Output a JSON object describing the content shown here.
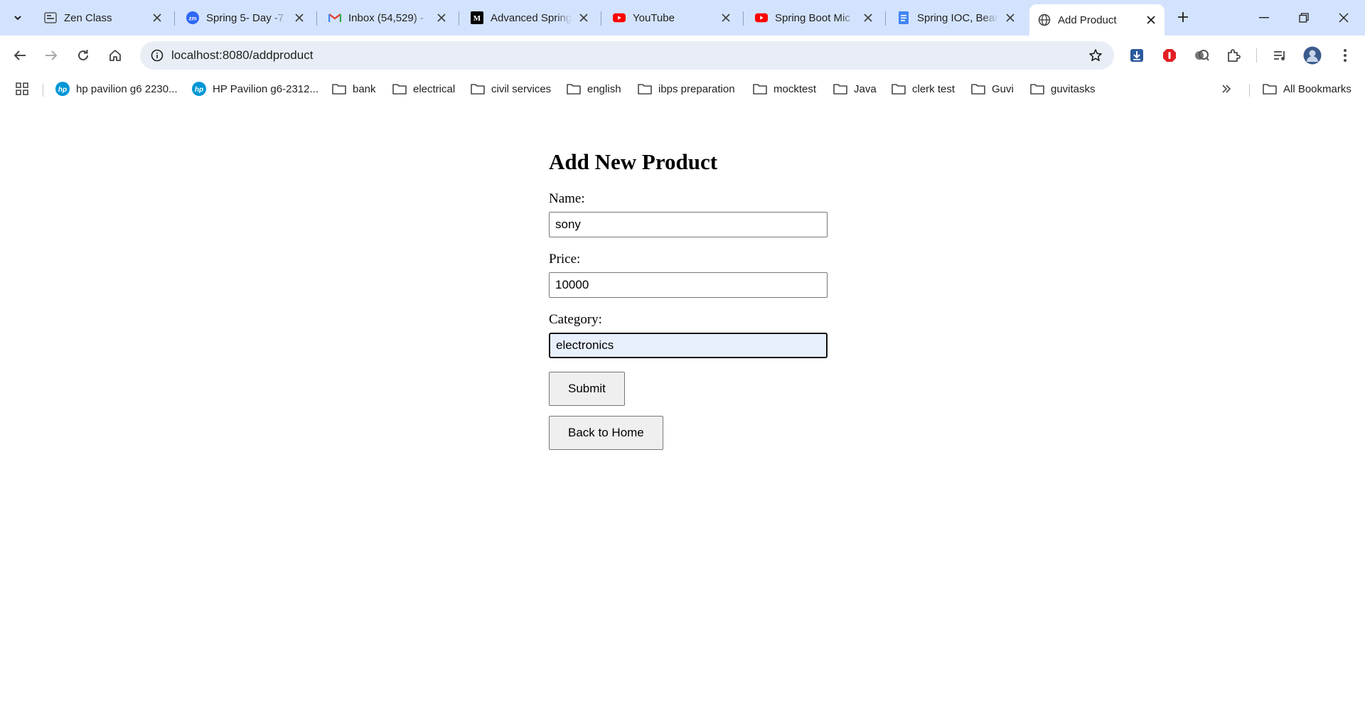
{
  "browser": {
    "tabs": [
      {
        "title": "Zen Class",
        "icon": "zen-class-icon"
      },
      {
        "title": "Spring 5- Day -7",
        "icon": "zoom-icon"
      },
      {
        "title": "Inbox (54,529) -",
        "icon": "gmail-icon"
      },
      {
        "title": "Advanced Spring",
        "icon": "medium-icon"
      },
      {
        "title": "YouTube",
        "icon": "youtube-icon"
      },
      {
        "title": "Spring Boot Mic",
        "icon": "youtube-icon"
      },
      {
        "title": "Spring IOC, Bear",
        "icon": "docs-icon"
      },
      {
        "title": "Add Product",
        "icon": "globe-icon",
        "active": true
      }
    ],
    "url": "localhost:8080/addproduct",
    "bookmarks": [
      {
        "label": "hp pavilion g6 2230...",
        "icon": "hp-icon"
      },
      {
        "label": "HP Pavilion g6-2312...",
        "icon": "hp-icon"
      },
      {
        "label": "bank",
        "icon": "folder-icon"
      },
      {
        "label": "electrical",
        "icon": "folder-icon"
      },
      {
        "label": "civil services",
        "icon": "folder-icon"
      },
      {
        "label": "english",
        "icon": "folder-icon"
      },
      {
        "label": "ibps preparation",
        "icon": "folder-icon"
      },
      {
        "label": "mocktest",
        "icon": "folder-icon"
      },
      {
        "label": "Java",
        "icon": "folder-icon"
      },
      {
        "label": "clerk test",
        "icon": "folder-icon"
      },
      {
        "label": "Guvi",
        "icon": "folder-icon"
      },
      {
        "label": "guvitasks",
        "icon": "folder-icon"
      }
    ],
    "all_bookmarks": "All Bookmarks"
  },
  "page": {
    "heading": "Add New Product",
    "name_label": "Name:",
    "name_value": "sony",
    "price_label": "Price:",
    "price_value": "10000",
    "category_label": "Category:",
    "category_value": "electronics",
    "submit_label": "Submit",
    "back_label": "Back to Home"
  },
  "colors": {
    "tabstrip": "#d3e3fd",
    "omnibox": "#e9eef6",
    "focused_input": "#e8f0fe"
  }
}
